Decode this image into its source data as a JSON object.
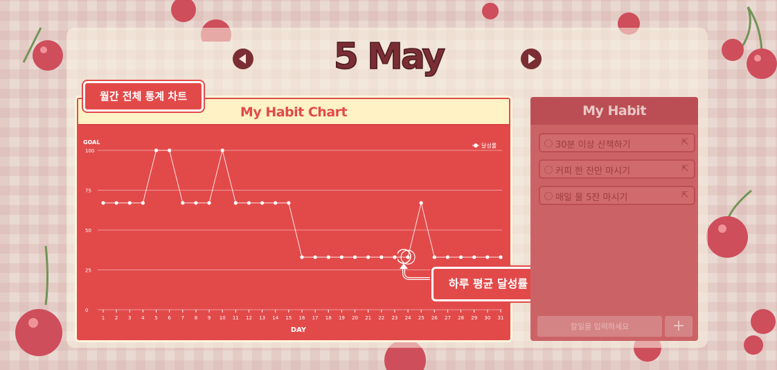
{
  "month_title": "5 May",
  "nav": {
    "prev_icon": "chevron-left-icon",
    "next_icon": "chevron-right-icon"
  },
  "callouts": {
    "top": "월간 전체 통계 차트",
    "bottom": "하루 평균 달성률"
  },
  "chart_card": {
    "title": "My Habit Chart"
  },
  "habit_panel": {
    "title": "My Habit",
    "items": [
      {
        "label": "30분 이상 산책하기"
      },
      {
        "label": "커피 한 잔만 마시기"
      },
      {
        "label": "매일 물 5잔 마시기"
      }
    ],
    "input_placeholder": "할일을 입력하세요",
    "add_label": "+"
  },
  "colors": {
    "chart_bg": "#e24a4a",
    "header_bg": "#fff2c4",
    "accent": "#7a2e34"
  },
  "chart_data": {
    "type": "line",
    "goal_label": "GOAL",
    "xlabel": "DAY",
    "ylim": [
      0,
      100
    ],
    "yticks": [
      0,
      25,
      50,
      75,
      100
    ],
    "legend": "top-right",
    "categories": [
      "1",
      "2",
      "3",
      "4",
      "5",
      "6",
      "7",
      "8",
      "9",
      "10",
      "11",
      "12",
      "13",
      "14",
      "15",
      "16",
      "17",
      "18",
      "19",
      "20",
      "21",
      "22",
      "23",
      "24",
      "25",
      "26",
      "27",
      "28",
      "29",
      "30",
      "31"
    ],
    "series": [
      {
        "name": "달성률",
        "values": [
          67,
          67,
          67,
          67,
          100,
          100,
          67,
          67,
          67,
          100,
          67,
          67,
          67,
          67,
          67,
          33,
          33,
          33,
          33,
          33,
          33,
          33,
          33,
          33,
          67,
          33,
          33,
          33,
          33,
          33,
          33
        ]
      }
    ],
    "highlight_day": "24"
  }
}
